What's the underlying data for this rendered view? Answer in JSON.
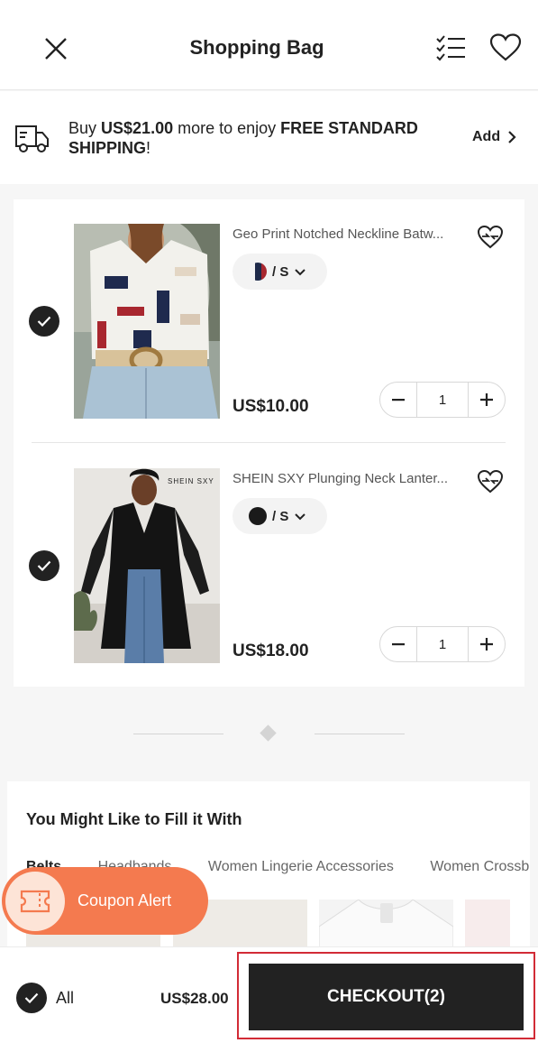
{
  "header": {
    "title": "Shopping Bag",
    "close_icon": "close-icon",
    "list_icon": "checklist-icon",
    "wishlist_icon": "heart-icon"
  },
  "shipping_banner": {
    "prefix": "Buy ",
    "amount": "US$21.00",
    "middle": " more to enjoy ",
    "highlight": "FREE STANDARD SHIPPING",
    "suffix": "!",
    "add_label": "Add"
  },
  "cart": {
    "items": [
      {
        "name": "Geo Print Notched Neckline Batw...",
        "size": "/ S",
        "price": "US$10.00",
        "quantity": "1",
        "selected": true,
        "swatch_color": "#1e2a4a"
      },
      {
        "name": "SHEIN SXY Plunging Neck Lanter...",
        "size": "/ S",
        "price": "US$18.00",
        "quantity": "1",
        "selected": true,
        "swatch_color": "#1a1a1a"
      }
    ],
    "photo_brand": "SHEIN SXY"
  },
  "recommendations": {
    "title": "You Might Like to Fill it With",
    "tabs": [
      "Belts",
      "Headbands",
      "Women Lingerie Accessories",
      "Women Crossb"
    ]
  },
  "coupon": {
    "label": "Coupon Alert"
  },
  "bottom_bar": {
    "all_label": "All",
    "total": "US$28.00",
    "checkout_label": "CHECKOUT(2)"
  },
  "colors": {
    "accent": "#222222",
    "coupon": "#f47a4f",
    "highlight_frame": "#d22b36"
  }
}
